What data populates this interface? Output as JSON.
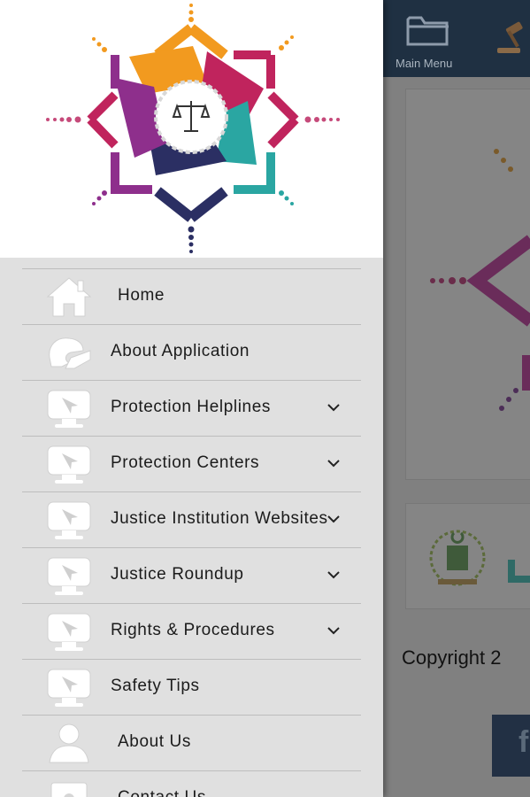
{
  "background_app": {
    "toolbar": {
      "main_menu_label": "Main Menu"
    },
    "footer": {
      "copyright_text": "Copyright 2",
      "facebook_glyph": "f"
    }
  },
  "drawer": {
    "header_logo": "justice-app-logo",
    "items": [
      {
        "label": "Home",
        "icon": "home-icon",
        "has_chevron": false
      },
      {
        "label": "About Application",
        "icon": "info-hands-icon",
        "has_chevron": false
      },
      {
        "label": "Protection Helplines",
        "icon": "monitor-cursor-icon",
        "has_chevron": true
      },
      {
        "label": "Protection Centers",
        "icon": "monitor-cursor-icon",
        "has_chevron": true
      },
      {
        "label": "Justice Institution Websites",
        "icon": "monitor-cursor-icon",
        "has_chevron": true
      },
      {
        "label": "Justice Roundup",
        "icon": "monitor-cursor-icon",
        "has_chevron": true
      },
      {
        "label": "Rights & Procedures",
        "icon": "monitor-cursor-icon",
        "has_chevron": true
      },
      {
        "label": "Safety Tips",
        "icon": "monitor-cursor-icon",
        "has_chevron": false
      },
      {
        "label": "About Us",
        "icon": "person-icon",
        "has_chevron": false
      },
      {
        "label": "Contact Us",
        "icon": "contact-card-icon",
        "has_chevron": false
      }
    ]
  },
  "colors": {
    "drawer_bg": "#e0e0e0",
    "toolbar_bg": "#1f3042",
    "logo_orange": "#f29a1f",
    "logo_purple": "#8e2f8c",
    "logo_magenta": "#c0245d",
    "logo_teal": "#2aa6a2",
    "logo_navy": "#2b2f63"
  }
}
